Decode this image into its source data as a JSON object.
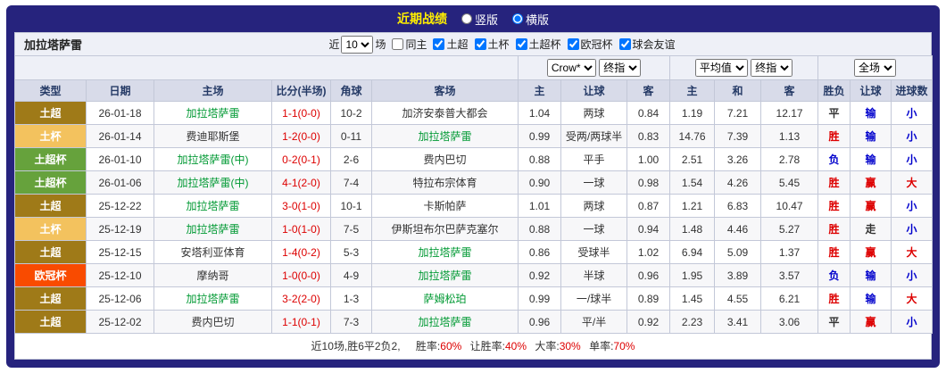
{
  "topbar": {
    "title": "近期战绩",
    "views": [
      {
        "label": "竖版",
        "selected": false
      },
      {
        "label": "横版",
        "selected": true
      }
    ]
  },
  "filterbar": {
    "team": "加拉塔萨雷",
    "recent_label": "近",
    "recent_count": "10",
    "games_label": "场",
    "checkboxes": [
      {
        "label": "同主",
        "checked": false
      },
      {
        "label": "土超",
        "checked": true
      },
      {
        "label": "土杯",
        "checked": true
      },
      {
        "label": "土超杯",
        "checked": true
      },
      {
        "label": "欧冠杯",
        "checked": true
      },
      {
        "label": "球会友谊",
        "checked": true
      }
    ]
  },
  "selectors": {
    "bookmaker": "Crow*",
    "bookmaker_stage": "终指",
    "europe": "平均值",
    "europe_stage": "终指",
    "scope": "全场"
  },
  "table": {
    "headers": [
      "类型",
      "日期",
      "主场",
      "比分(半场)",
      "角球",
      "客场",
      "主",
      "让球",
      "客",
      "主",
      "和",
      "客",
      "胜负",
      "让球",
      "进球数"
    ],
    "rows": [
      {
        "league": "土超",
        "date": "26-01-18",
        "home": {
          "t": "加拉塔萨雷",
          "hl": true
        },
        "score": "1-1(0-0)",
        "corner": "10-2",
        "away": {
          "t": "加济安泰普大都会",
          "hl": false
        },
        "ah": [
          "1.04",
          "两球",
          "0.84"
        ],
        "eu": [
          "1.19",
          "7.21",
          "12.17"
        ],
        "res": [
          {
            "t": "平",
            "c": "neutral"
          },
          {
            "t": "输",
            "c": "lose"
          },
          {
            "t": "小",
            "c": "lose"
          }
        ]
      },
      {
        "league": "土杯",
        "date": "26-01-14",
        "home": {
          "t": "费迪耶斯堡",
          "hl": false
        },
        "score": "1-2(0-0)",
        "corner": "0-11",
        "away": {
          "t": "加拉塔萨雷",
          "hl": true
        },
        "ah": [
          "0.99",
          "受两/两球半",
          "0.83"
        ],
        "eu": [
          "14.76",
          "7.39",
          "1.13"
        ],
        "res": [
          {
            "t": "胜",
            "c": "win"
          },
          {
            "t": "输",
            "c": "lose"
          },
          {
            "t": "小",
            "c": "lose"
          }
        ]
      },
      {
        "league": "土超杯",
        "date": "26-01-10",
        "home": {
          "t": "加拉塔萨雷(中)",
          "hl": true
        },
        "score": "0-2(0-1)",
        "corner": "2-6",
        "away": {
          "t": "费内巴切",
          "hl": false
        },
        "ah": [
          "0.88",
          "平手",
          "1.00"
        ],
        "eu": [
          "2.51",
          "3.26",
          "2.78"
        ],
        "res": [
          {
            "t": "负",
            "c": "lose"
          },
          {
            "t": "输",
            "c": "lose"
          },
          {
            "t": "小",
            "c": "lose"
          }
        ]
      },
      {
        "league": "土超杯",
        "date": "26-01-06",
        "home": {
          "t": "加拉塔萨雷(中)",
          "hl": true
        },
        "score": "4-1(2-0)",
        "corner": "7-4",
        "away": {
          "t": "特拉布宗体育",
          "hl": false
        },
        "ah": [
          "0.90",
          "一球",
          "0.98"
        ],
        "eu": [
          "1.54",
          "4.26",
          "5.45"
        ],
        "res": [
          {
            "t": "胜",
            "c": "win"
          },
          {
            "t": "赢",
            "c": "win"
          },
          {
            "t": "大",
            "c": "win"
          }
        ]
      },
      {
        "league": "土超",
        "date": "25-12-22",
        "home": {
          "t": "加拉塔萨雷",
          "hl": true
        },
        "score": "3-0(1-0)",
        "corner": "10-1",
        "away": {
          "t": "卡斯帕萨",
          "hl": false
        },
        "ah": [
          "1.01",
          "两球",
          "0.87"
        ],
        "eu": [
          "1.21",
          "6.83",
          "10.47"
        ],
        "res": [
          {
            "t": "胜",
            "c": "win"
          },
          {
            "t": "赢",
            "c": "win"
          },
          {
            "t": "小",
            "c": "lose"
          }
        ]
      },
      {
        "league": "土杯",
        "date": "25-12-19",
        "home": {
          "t": "加拉塔萨雷",
          "hl": true
        },
        "score": "1-0(1-0)",
        "corner": "7-5",
        "away": {
          "t": "伊斯坦布尔巴萨克塞尔",
          "hl": false
        },
        "ah": [
          "0.88",
          "一球",
          "0.94"
        ],
        "eu": [
          "1.48",
          "4.46",
          "5.27"
        ],
        "res": [
          {
            "t": "胜",
            "c": "win"
          },
          {
            "t": "走",
            "c": "neutral"
          },
          {
            "t": "小",
            "c": "lose"
          }
        ]
      },
      {
        "league": "土超",
        "date": "25-12-15",
        "home": {
          "t": "安塔利亚体育",
          "hl": false
        },
        "score": "1-4(0-2)",
        "corner": "5-3",
        "away": {
          "t": "加拉塔萨雷",
          "hl": true
        },
        "ah": [
          "0.86",
          "受球半",
          "1.02"
        ],
        "eu": [
          "6.94",
          "5.09",
          "1.37"
        ],
        "res": [
          {
            "t": "胜",
            "c": "win"
          },
          {
            "t": "赢",
            "c": "win"
          },
          {
            "t": "大",
            "c": "win"
          }
        ]
      },
      {
        "league": "欧冠杯",
        "date": "25-12-10",
        "home": {
          "t": "摩纳哥",
          "hl": false
        },
        "score": "1-0(0-0)",
        "corner": "4-9",
        "away": {
          "t": "加拉塔萨雷",
          "hl": true
        },
        "ah": [
          "0.92",
          "半球",
          "0.96"
        ],
        "eu": [
          "1.95",
          "3.89",
          "3.57"
        ],
        "res": [
          {
            "t": "负",
            "c": "lose"
          },
          {
            "t": "输",
            "c": "lose"
          },
          {
            "t": "小",
            "c": "lose"
          }
        ]
      },
      {
        "league": "土超",
        "date": "25-12-06",
        "home": {
          "t": "加拉塔萨雷",
          "hl": true
        },
        "score": "3-2(2-0)",
        "corner": "1-3",
        "away": {
          "t": "萨姆松珀",
          "hl": true
        },
        "ah": [
          "0.99",
          "一/球半",
          "0.89"
        ],
        "eu": [
          "1.45",
          "4.55",
          "6.21"
        ],
        "res": [
          {
            "t": "胜",
            "c": "win"
          },
          {
            "t": "输",
            "c": "lose"
          },
          {
            "t": "大",
            "c": "win"
          }
        ]
      },
      {
        "league": "土超",
        "date": "25-12-02",
        "home": {
          "t": "费内巴切",
          "hl": false
        },
        "score": "1-1(0-1)",
        "corner": "7-3",
        "away": {
          "t": "加拉塔萨雷",
          "hl": true
        },
        "ah": [
          "0.96",
          "平/半",
          "0.92"
        ],
        "eu": [
          "2.23",
          "3.41",
          "3.06"
        ],
        "res": [
          {
            "t": "平",
            "c": "neutral"
          },
          {
            "t": "赢",
            "c": "win"
          },
          {
            "t": "小",
            "c": "lose"
          }
        ]
      }
    ]
  },
  "footer": {
    "summary": "近10场,胜6平2负2,",
    "stats": [
      {
        "label": "胜率:",
        "value": "60%"
      },
      {
        "label": "让胜率:",
        "value": "40%"
      },
      {
        "label": "大率:",
        "value": "30%"
      },
      {
        "label": "单率:",
        "value": "70%"
      }
    ]
  },
  "colors": {
    "leagues": {
      "土超": "#9f7a18",
      "土杯": "#f3c25e",
      "土超杯": "#66a23c",
      "欧冠杯": "#f94b00"
    },
    "win": "#dd0000",
    "lose": "#0000cc",
    "neutral": "#333333",
    "team_highlight": "#009933"
  }
}
